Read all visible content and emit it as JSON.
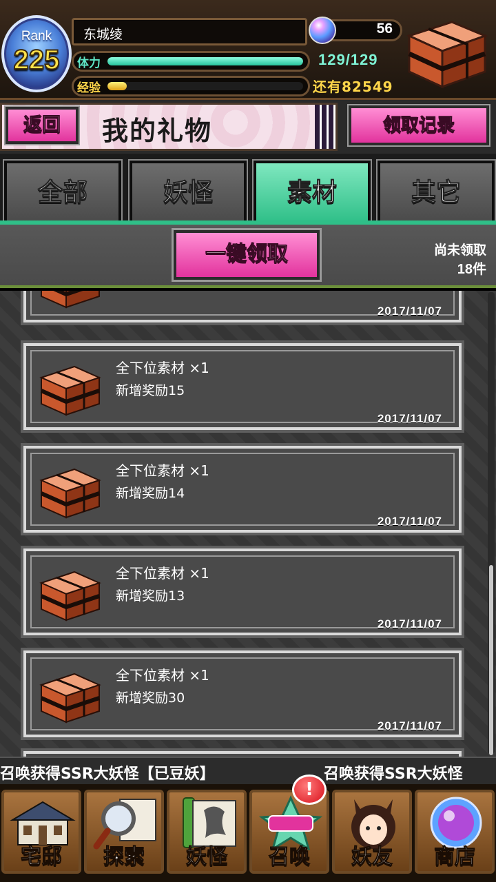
{
  "header": {
    "rank_word": "Rank",
    "rank_value": "225",
    "player_name": "东城绫",
    "stamina_label": "体力",
    "stamina_value": "129/129",
    "stamina_fraction": 1.0,
    "exp_label": "经验",
    "exp_fraction": 0.1,
    "exp_remaining": "还有82549",
    "orb_count": "56"
  },
  "title_bar": {
    "back_label": "返回",
    "title": "我的礼物",
    "history_label": "领取记录"
  },
  "tabs": [
    {
      "label": "全部",
      "active": false
    },
    {
      "label": "妖怪",
      "active": false
    },
    {
      "label": "素材",
      "active": true
    },
    {
      "label": "其它",
      "active": false
    }
  ],
  "action_bar": {
    "claim_all_label": "一键领取",
    "pending_label": "尚未领取",
    "pending_count": "18件"
  },
  "gifts": [
    {
      "name": "",
      "source": "",
      "date": "2017/11/07"
    },
    {
      "name": "全下位素材 ×1",
      "source": "新增奖励15",
      "date": "2017/11/07"
    },
    {
      "name": "全下位素材 ×1",
      "source": "新增奖励14",
      "date": "2017/11/07"
    },
    {
      "name": "全下位素材 ×1",
      "source": "新增奖励13",
      "date": "2017/11/07"
    },
    {
      "name": "全下位素材 ×1",
      "source": "新增奖励30",
      "date": "2017/11/07"
    }
  ],
  "ticker": {
    "text_1": "召唤获得SSR大妖怪【已豆妖】",
    "text_2": "召唤获得SSR大妖怪"
  },
  "bottom_nav": [
    {
      "label": "宅邸",
      "icon": "mansion-icon"
    },
    {
      "label": "探索",
      "icon": "magnifier-map-icon"
    },
    {
      "label": "妖怪",
      "icon": "yokai-scroll-icon"
    },
    {
      "label": "召唤",
      "icon": "summon-festival-icon"
    },
    {
      "label": "妖友",
      "icon": "fox-girl-icon"
    },
    {
      "label": "商店",
      "icon": "spirit-jade-orb-icon"
    }
  ],
  "summon_badge": "!",
  "colors": {
    "accent_pink": "#e2339d",
    "tab_active_green": "#2fbf88",
    "stamina_green": "#26c39c",
    "exp_gold": "#e0a418"
  }
}
